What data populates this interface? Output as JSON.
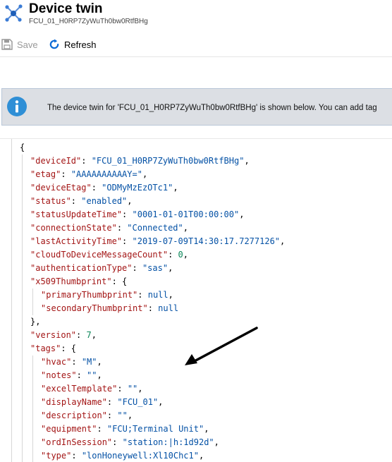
{
  "header": {
    "title": "Device twin",
    "subtitle": "FCU_01_H0RP7ZyWuTh0bw0RtfBHg",
    "icon": "iot-device-icon"
  },
  "toolbar": {
    "save_label": "Save",
    "save_icon": "floppy-disk-icon",
    "refresh_label": "Refresh",
    "refresh_icon": "refresh-icon"
  },
  "banner": {
    "icon": "info-icon",
    "text": "The device twin for 'FCU_01_H0RP7ZyWuTh0bw0RtfBHg' is shown below. You can add tag"
  },
  "json_lines": [
    {
      "indent": 0,
      "parts": [
        {
          "t": "p",
          "v": "{"
        }
      ]
    },
    {
      "indent": 1,
      "parts": [
        {
          "t": "k",
          "v": "\"deviceId\""
        },
        {
          "t": "p",
          "v": ": "
        },
        {
          "t": "s",
          "v": "\"FCU_01_H0RP7ZyWuTh0bw0RtfBHg\""
        },
        {
          "t": "p",
          "v": ","
        }
      ]
    },
    {
      "indent": 1,
      "parts": [
        {
          "t": "k",
          "v": "\"etag\""
        },
        {
          "t": "p",
          "v": ": "
        },
        {
          "t": "s",
          "v": "\"AAAAAAAAAAY=\""
        },
        {
          "t": "p",
          "v": ","
        }
      ]
    },
    {
      "indent": 1,
      "parts": [
        {
          "t": "k",
          "v": "\"deviceEtag\""
        },
        {
          "t": "p",
          "v": ": "
        },
        {
          "t": "s",
          "v": "\"ODMyMzEzOTc1\""
        },
        {
          "t": "p",
          "v": ","
        }
      ]
    },
    {
      "indent": 1,
      "parts": [
        {
          "t": "k",
          "v": "\"status\""
        },
        {
          "t": "p",
          "v": ": "
        },
        {
          "t": "s",
          "v": "\"enabled\""
        },
        {
          "t": "p",
          "v": ","
        }
      ]
    },
    {
      "indent": 1,
      "parts": [
        {
          "t": "k",
          "v": "\"statusUpdateTime\""
        },
        {
          "t": "p",
          "v": ": "
        },
        {
          "t": "s",
          "v": "\"0001-01-01T00:00:00\""
        },
        {
          "t": "p",
          "v": ","
        }
      ]
    },
    {
      "indent": 1,
      "parts": [
        {
          "t": "k",
          "v": "\"connectionState\""
        },
        {
          "t": "p",
          "v": ": "
        },
        {
          "t": "s",
          "v": "\"Connected\""
        },
        {
          "t": "p",
          "v": ","
        }
      ]
    },
    {
      "indent": 1,
      "parts": [
        {
          "t": "k",
          "v": "\"lastActivityTime\""
        },
        {
          "t": "p",
          "v": ": "
        },
        {
          "t": "s",
          "v": "\"2019-07-09T14:30:17.7277126\""
        },
        {
          "t": "p",
          "v": ","
        }
      ]
    },
    {
      "indent": 1,
      "parts": [
        {
          "t": "k",
          "v": "\"cloudToDeviceMessageCount\""
        },
        {
          "t": "p",
          "v": ": "
        },
        {
          "t": "n",
          "v": "0"
        },
        {
          "t": "p",
          "v": ","
        }
      ]
    },
    {
      "indent": 1,
      "parts": [
        {
          "t": "k",
          "v": "\"authenticationType\""
        },
        {
          "t": "p",
          "v": ": "
        },
        {
          "t": "s",
          "v": "\"sas\""
        },
        {
          "t": "p",
          "v": ","
        }
      ]
    },
    {
      "indent": 1,
      "parts": [
        {
          "t": "k",
          "v": "\"x509Thumbprint\""
        },
        {
          "t": "p",
          "v": ": {"
        }
      ]
    },
    {
      "indent": 2,
      "parts": [
        {
          "t": "k",
          "v": "\"primaryThumbprint\""
        },
        {
          "t": "p",
          "v": ": "
        },
        {
          "t": "l",
          "v": "null"
        },
        {
          "t": "p",
          "v": ","
        }
      ]
    },
    {
      "indent": 2,
      "parts": [
        {
          "t": "k",
          "v": "\"secondaryThumbprint\""
        },
        {
          "t": "p",
          "v": ": "
        },
        {
          "t": "l",
          "v": "null"
        }
      ]
    },
    {
      "indent": 1,
      "parts": [
        {
          "t": "p",
          "v": "},"
        }
      ]
    },
    {
      "indent": 1,
      "parts": [
        {
          "t": "k",
          "v": "\"version\""
        },
        {
          "t": "p",
          "v": ": "
        },
        {
          "t": "n",
          "v": "7"
        },
        {
          "t": "p",
          "v": ","
        }
      ]
    },
    {
      "indent": 1,
      "parts": [
        {
          "t": "k",
          "v": "\"tags\""
        },
        {
          "t": "p",
          "v": ": {"
        }
      ]
    },
    {
      "indent": 2,
      "parts": [
        {
          "t": "k",
          "v": "\"hvac\""
        },
        {
          "t": "p",
          "v": ": "
        },
        {
          "t": "s",
          "v": "\"M\""
        },
        {
          "t": "p",
          "v": ","
        }
      ]
    },
    {
      "indent": 2,
      "parts": [
        {
          "t": "k",
          "v": "\"notes\""
        },
        {
          "t": "p",
          "v": ": "
        },
        {
          "t": "s",
          "v": "\"\""
        },
        {
          "t": "p",
          "v": ","
        }
      ]
    },
    {
      "indent": 2,
      "parts": [
        {
          "t": "k",
          "v": "\"excelTemplate\""
        },
        {
          "t": "p",
          "v": ": "
        },
        {
          "t": "s",
          "v": "\"\""
        },
        {
          "t": "p",
          "v": ","
        }
      ]
    },
    {
      "indent": 2,
      "parts": [
        {
          "t": "k",
          "v": "\"displayName\""
        },
        {
          "t": "p",
          "v": ": "
        },
        {
          "t": "s",
          "v": "\"FCU_01\""
        },
        {
          "t": "p",
          "v": ","
        }
      ]
    },
    {
      "indent": 2,
      "parts": [
        {
          "t": "k",
          "v": "\"description\""
        },
        {
          "t": "p",
          "v": ": "
        },
        {
          "t": "s",
          "v": "\"\""
        },
        {
          "t": "p",
          "v": ","
        }
      ]
    },
    {
      "indent": 2,
      "parts": [
        {
          "t": "k",
          "v": "\"equipment\""
        },
        {
          "t": "p",
          "v": ": "
        },
        {
          "t": "s",
          "v": "\"FCU;Terminal Unit\""
        },
        {
          "t": "p",
          "v": ","
        }
      ]
    },
    {
      "indent": 2,
      "parts": [
        {
          "t": "k",
          "v": "\"ordInSession\""
        },
        {
          "t": "p",
          "v": ": "
        },
        {
          "t": "s",
          "v": "\"station:|h:1d92d\""
        },
        {
          "t": "p",
          "v": ","
        }
      ]
    },
    {
      "indent": 2,
      "parts": [
        {
          "t": "k",
          "v": "\"type\""
        },
        {
          "t": "p",
          "v": ": "
        },
        {
          "t": "s",
          "v": "\"lonHoneywell:Xl10Chc1\""
        },
        {
          "t": "p",
          "v": ","
        }
      ]
    }
  ],
  "annotation_arrow_icon": "arrow-pointer-icon",
  "colors": {
    "key": "#a31515",
    "string": "#0451a5",
    "number": "#098658",
    "literal": "#0451a5",
    "banner_bg": "#dcdfe4",
    "info_blue": "#2f8fd6",
    "refresh_blue": "#0b6ad6"
  }
}
